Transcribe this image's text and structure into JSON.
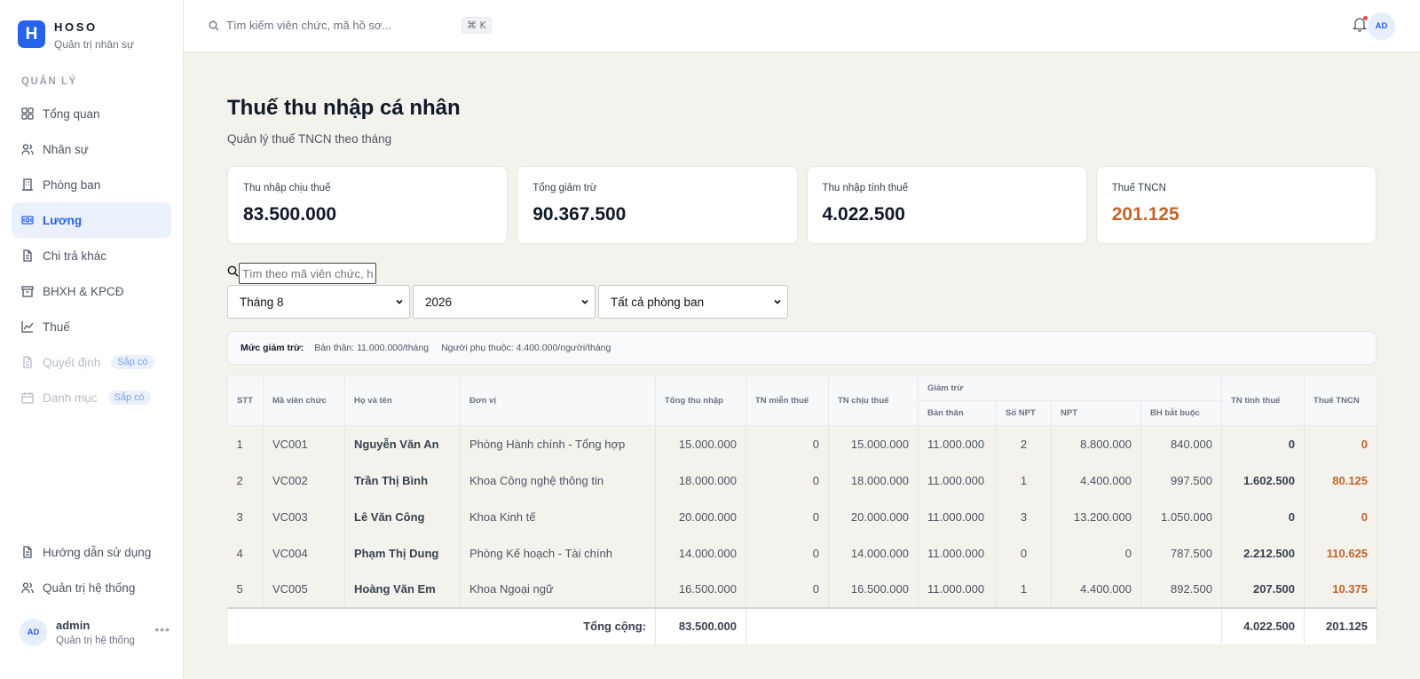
{
  "brand": {
    "logo": "H",
    "name": "HOSO",
    "subtitle": "Quản trị nhân sự"
  },
  "sidebar": {
    "section": "QUẢN LÝ",
    "items": [
      {
        "label": "Tổng quan",
        "icon": "grid-icon"
      },
      {
        "label": "Nhân sự",
        "icon": "users-icon"
      },
      {
        "label": "Phòng ban",
        "icon": "building-icon"
      },
      {
        "label": "Lương",
        "icon": "money-icon",
        "active": true
      },
      {
        "label": "Chi trả khác",
        "icon": "file-icon"
      },
      {
        "label": "BHXH & KPCĐ",
        "icon": "archive-icon"
      },
      {
        "label": "Thuế",
        "icon": "chart-icon"
      },
      {
        "label": "Quyết định",
        "icon": "document-icon",
        "badge": "Sắp có"
      },
      {
        "label": "Danh mục",
        "icon": "calendar-icon",
        "badge": "Sắp có"
      }
    ],
    "bottom": [
      {
        "label": "Hướng dẫn sử dụng",
        "icon": "file-icon"
      },
      {
        "label": "Quản trị hệ thống",
        "icon": "users-icon"
      }
    ],
    "user": {
      "initials": "AD",
      "name": "admin",
      "role": "Quản trị hệ thống"
    }
  },
  "topbar": {
    "search_placeholder": "Tìm kiếm viên chức, mã hồ sơ...",
    "shortcut": "⌘ K",
    "avatar": "AD"
  },
  "page": {
    "title": "Thuế thu nhập cá nhân",
    "subtitle": "Quản lý thuế TNCN theo tháng"
  },
  "cards": [
    {
      "label": "Thu nhập chịu thuế",
      "value": "83.500.000"
    },
    {
      "label": "Tổng giảm trừ",
      "value": "90.367.500"
    },
    {
      "label": "Thu nhập tính thuế",
      "value": "4.022.500"
    },
    {
      "label": "Thuế TNCN",
      "value": "201.125"
    }
  ],
  "filters": {
    "search_placeholder": "Tìm theo mã viên chức, họ tên...",
    "month": "Tháng 8",
    "year": "2026",
    "department": "Tất cả phòng ban"
  },
  "deduction": {
    "label": "Mức giảm trừ:",
    "self": "Bản thân: 11.000.000/tháng",
    "dependent": "Người phụ thuộc: 4.400.000/người/tháng"
  },
  "table": {
    "headers": {
      "stt": "STT",
      "code": "Mã viên chức",
      "name": "Họ và tên",
      "unit": "Đơn vị",
      "gross": "Tổng thu nhập",
      "exempt": "TN miễn thuế",
      "taxable": "TN chịu thuế",
      "deduction": "Giảm trừ",
      "self": "Bản thân",
      "npt_count": "Số NPT",
      "npt": "NPT",
      "insurance": "BH bắt buộc",
      "assessable": "TN tính thuế",
      "tax": "Thuế TNCN"
    },
    "rows": [
      {
        "stt": "1",
        "code": "VC001",
        "name": "Nguyễn Văn An",
        "unit": "Phòng Hành chính - Tổng hợp",
        "gross": "15.000.000",
        "exempt": "0",
        "taxable": "15.000.000",
        "self": "11.000.000",
        "npt_count": "2",
        "npt": "8.800.000",
        "insurance": "840.000",
        "assessable": "0",
        "tax": "0"
      },
      {
        "stt": "2",
        "code": "VC002",
        "name": "Trần Thị Bình",
        "unit": "Khoa Công nghệ thông tin",
        "gross": "18.000.000",
        "exempt": "0",
        "taxable": "18.000.000",
        "self": "11.000.000",
        "npt_count": "1",
        "npt": "4.400.000",
        "insurance": "997.500",
        "assessable": "1.602.500",
        "tax": "80.125"
      },
      {
        "stt": "3",
        "code": "VC003",
        "name": "Lê Văn Công",
        "unit": "Khoa Kinh tế",
        "gross": "20.000.000",
        "exempt": "0",
        "taxable": "20.000.000",
        "self": "11.000.000",
        "npt_count": "3",
        "npt": "13.200.000",
        "insurance": "1.050.000",
        "assessable": "0",
        "tax": "0"
      },
      {
        "stt": "4",
        "code": "VC004",
        "name": "Phạm Thị Dung",
        "unit": "Phòng Kế hoạch - Tài chính",
        "gross": "14.000.000",
        "exempt": "0",
        "taxable": "14.000.000",
        "self": "11.000.000",
        "npt_count": "0",
        "npt": "0",
        "insurance": "787.500",
        "assessable": "2.212.500",
        "tax": "110.625"
      },
      {
        "stt": "5",
        "code": "VC005",
        "name": "Hoàng Văn Em",
        "unit": "Khoa Ngoại ngữ",
        "gross": "16.500.000",
        "exempt": "0",
        "taxable": "16.500.000",
        "self": "11.000.000",
        "npt_count": "1",
        "npt": "4.400.000",
        "insurance": "892.500",
        "assessable": "207.500",
        "tax": "10.375"
      }
    ],
    "total": {
      "label": "Tổng cộng:",
      "gross": "83.500.000",
      "assessable": "4.022.500",
      "tax": "201.125"
    }
  },
  "colors": {
    "accent": "#2563eb",
    "tax": "#c2652a",
    "background": "#f4f2ec"
  }
}
